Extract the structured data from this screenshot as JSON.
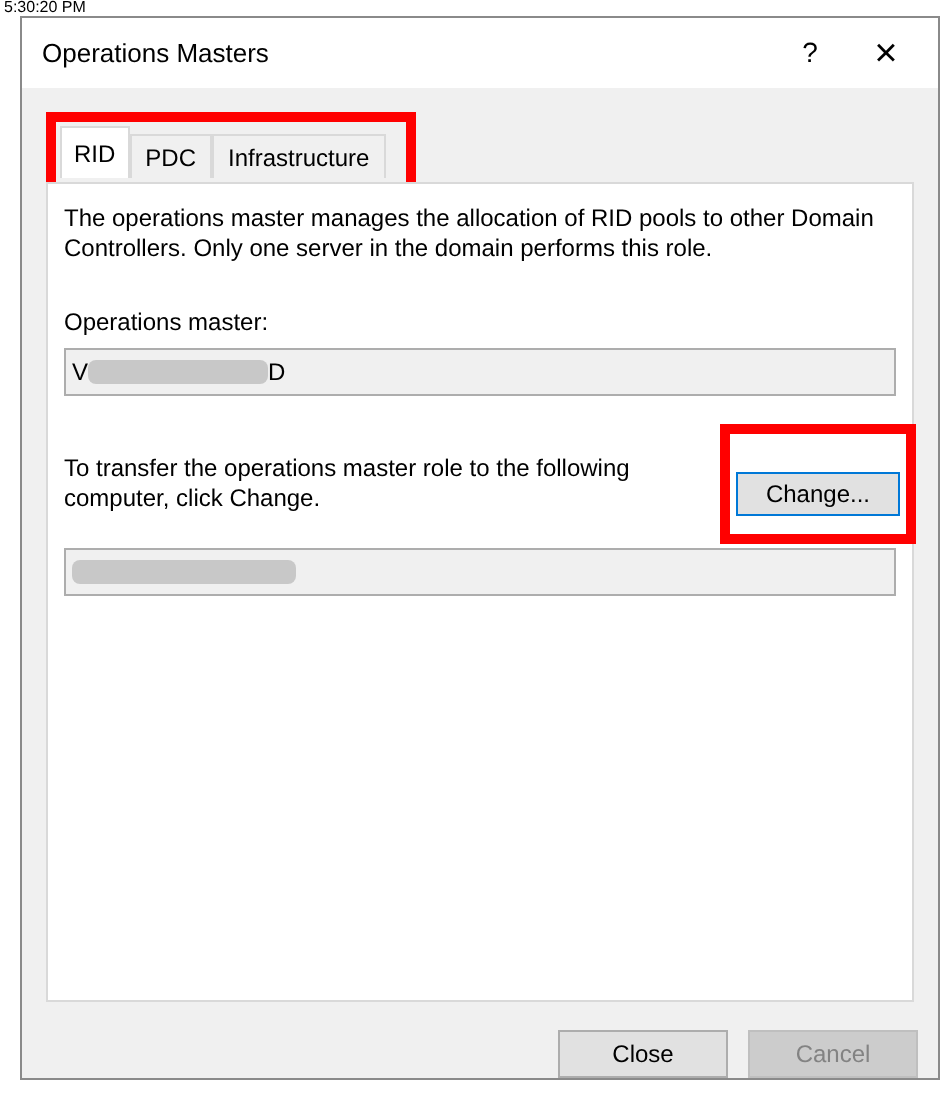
{
  "background_text": "5:30:20 PM",
  "window": {
    "title": "Operations Masters",
    "help_button": "?",
    "close_button": "×"
  },
  "tabs_highlighted": true,
  "tabs": [
    {
      "label": "RID",
      "selected": true
    },
    {
      "label": "PDC",
      "selected": false
    },
    {
      "label": "Infrastructure",
      "selected": false
    }
  ],
  "description": "The operations master manages the allocation of RID pools to other Domain Controllers. Only one server in the domain performs this role.",
  "operations_master": {
    "label": "Operations master:",
    "value_start": "V",
    "value_end": "D",
    "redacted": true
  },
  "transfer": {
    "text": "To transfer the operations master role to the following computer, click Change.",
    "button": "Change...",
    "button_highlighted": true,
    "target_redacted": true
  },
  "buttons": [
    {
      "label": "Close",
      "disabled": false
    },
    {
      "label": "Cancel",
      "disabled": true
    }
  ]
}
